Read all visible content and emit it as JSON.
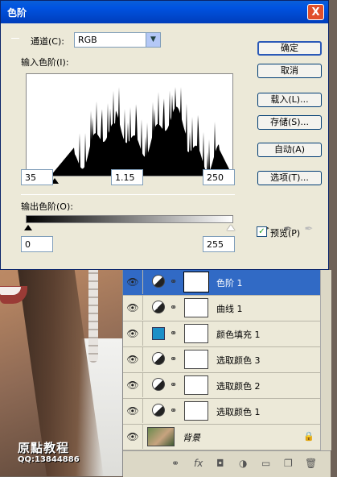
{
  "dialog": {
    "title": "色阶",
    "close_glyph": "X",
    "channel_label": "通道(C):",
    "channel_value": "RGB",
    "input_levels_label": "输入色阶(I):",
    "input_black": "35",
    "input_gamma": "1.15",
    "input_white": "250",
    "output_levels_label": "输出色阶(O):",
    "output_black": "0",
    "output_white": "255",
    "buttons": {
      "ok": "确定",
      "cancel": "取消",
      "load": "载入(L)...",
      "save": "存储(S)...",
      "auto": "自动(A)",
      "options": "选项(T)..."
    },
    "preview_label": "预览(P)",
    "preview_checked": true
  },
  "layers": [
    {
      "name": "色阶 1",
      "type": "adjustment",
      "selected": true
    },
    {
      "name": "曲线 1",
      "type": "adjustment",
      "selected": false
    },
    {
      "name": "颜色填充 1",
      "type": "fill",
      "selected": false
    },
    {
      "name": "选取颜色 3",
      "type": "adjustment",
      "selected": false
    },
    {
      "name": "选取颜色 2",
      "type": "adjustment",
      "selected": false
    },
    {
      "name": "选取颜色 1",
      "type": "adjustment",
      "selected": false
    },
    {
      "name": "背景",
      "type": "background",
      "selected": false
    }
  ],
  "watermark": {
    "title": "原點教程",
    "qq": "QQ:13844886"
  },
  "icons": {
    "eye": "eye-icon",
    "chain": "link-icon",
    "lock": "lock-icon",
    "eyedroppers": [
      "black-eyedropper-icon",
      "gray-eyedropper-icon",
      "white-eyedropper-icon"
    ]
  },
  "colors": {
    "titlebar": "#0054e3",
    "selected_layer": "#316ac5",
    "fill_layer": "#1c8fc8"
  }
}
